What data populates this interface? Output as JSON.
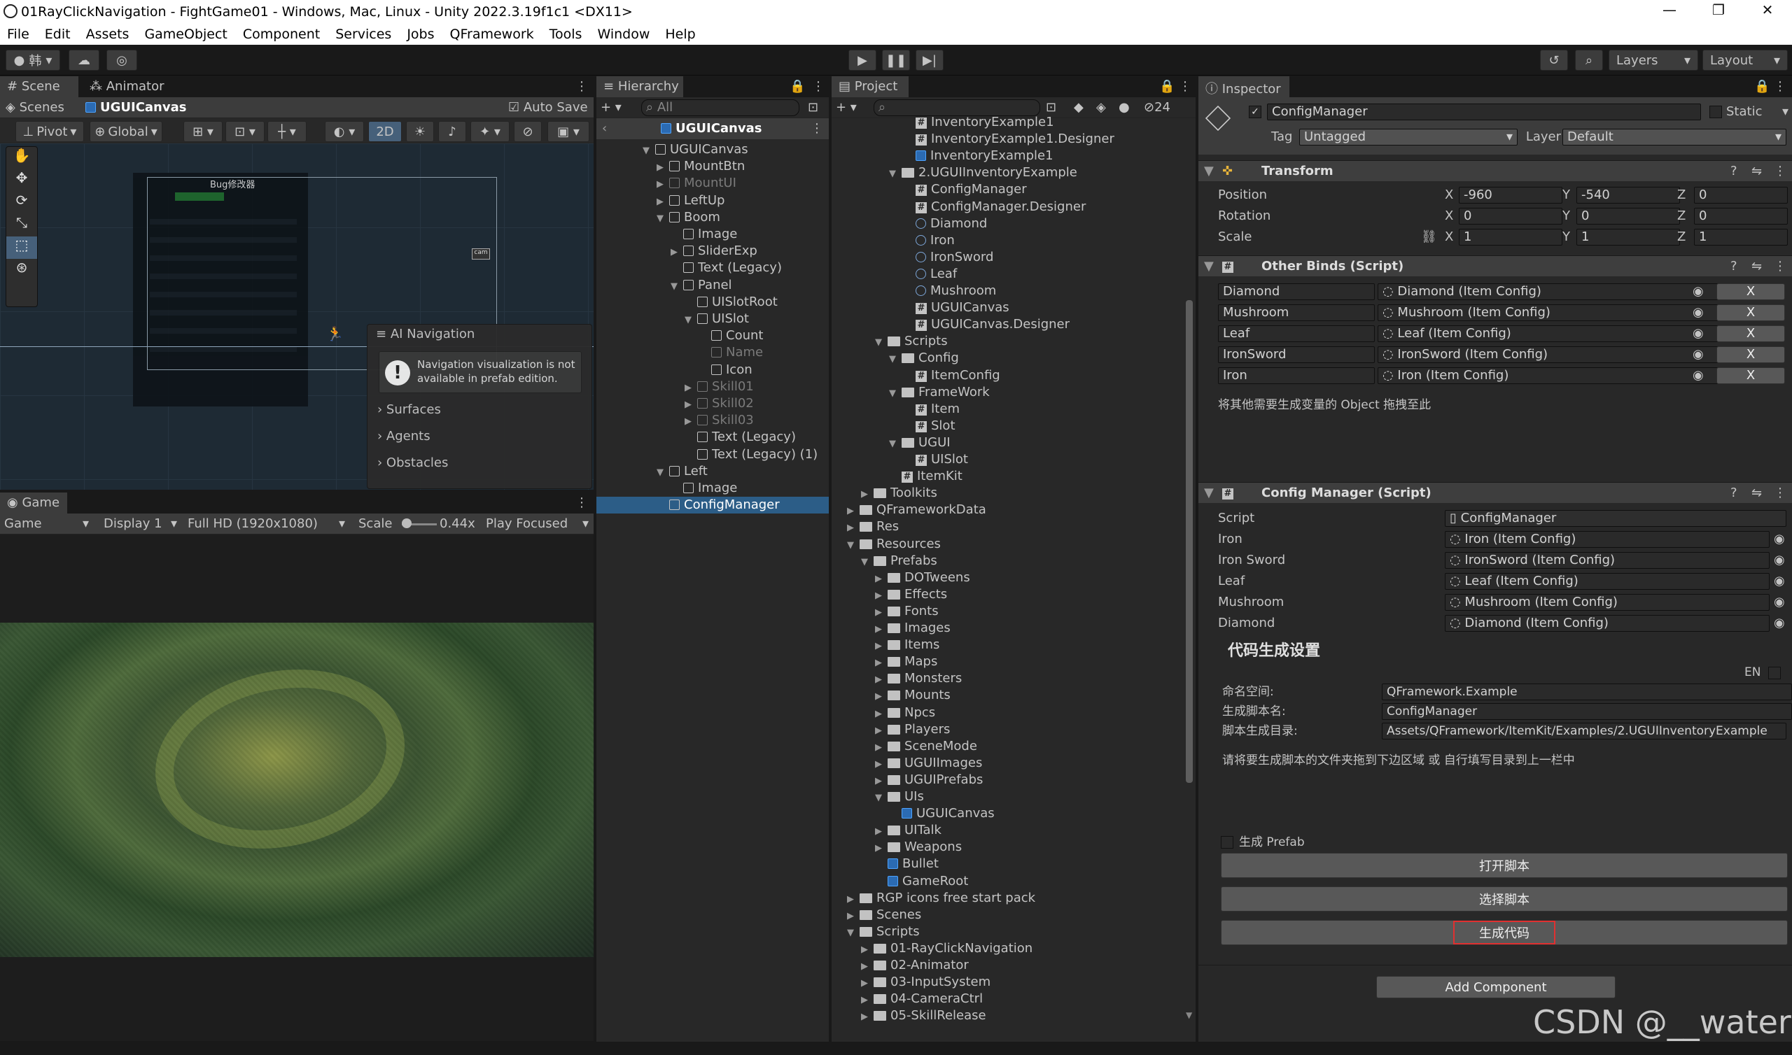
{
  "window": {
    "title": "01RayClickNavigation - FightGame01 - Windows, Mac, Linux - Unity 2022.3.19f1c1 <DX11>",
    "controls": [
      "—",
      "❐",
      "✕"
    ]
  },
  "menu": [
    "File",
    "Edit",
    "Assets",
    "GameObject",
    "Component",
    "Services",
    "Jobs",
    "QFramework",
    "Tools",
    "Window",
    "Help"
  ],
  "toolbar": {
    "account": "韩",
    "layers_label": "Layers",
    "layout_label": "Layout"
  },
  "scene": {
    "tabs": [
      "Scene",
      "Animator"
    ],
    "breadcrumb_root": "Scenes",
    "breadcrumb_object": "UGUICanvas",
    "auto_save": "Auto Save",
    "pivot": "Pivot",
    "global": "Global",
    "mode_2d": "2D",
    "ai_nav_title": "AI Navigation",
    "ai_nav_message": "Navigation visualization is not available in prefab edition.",
    "ai_nav_items": [
      "Surfaces",
      "Agents",
      "Obstacles"
    ],
    "bug_panel_title": "Bug修改器"
  },
  "game": {
    "tab": "Game",
    "mode": "Game",
    "display": "Display 1",
    "resolution": "Full HD (1920x1080)",
    "scale_label": "Scale",
    "scale_value": "0.44x",
    "play_focused": "Play Focused"
  },
  "hierarchy": {
    "tab": "Hierarchy",
    "search_placeholder": "All",
    "root": "UGUICanvas",
    "items": [
      {
        "label": "UGUICanvas",
        "depth": 0,
        "expanded": true,
        "dim": false
      },
      {
        "label": "MountBtn",
        "depth": 1,
        "expanded": false,
        "dim": false
      },
      {
        "label": "MountUI",
        "depth": 1,
        "expanded": false,
        "dim": true
      },
      {
        "label": "LeftUp",
        "depth": 1,
        "expanded": false,
        "dim": false
      },
      {
        "label": "Boom",
        "depth": 1,
        "expanded": true,
        "dim": false
      },
      {
        "label": "Image",
        "depth": 2,
        "expanded": null,
        "dim": false
      },
      {
        "label": "SliderExp",
        "depth": 2,
        "expanded": false,
        "dim": false
      },
      {
        "label": "Text (Legacy)",
        "depth": 2,
        "expanded": null,
        "dim": false
      },
      {
        "label": "Panel",
        "depth": 2,
        "expanded": true,
        "dim": false
      },
      {
        "label": "UISlotRoot",
        "depth": 3,
        "expanded": null,
        "dim": false
      },
      {
        "label": "UISlot",
        "depth": 3,
        "expanded": true,
        "dim": false
      },
      {
        "label": "Count",
        "depth": 4,
        "expanded": null,
        "dim": false
      },
      {
        "label": "Name",
        "depth": 4,
        "expanded": null,
        "dim": true
      },
      {
        "label": "Icon",
        "depth": 4,
        "expanded": null,
        "dim": false
      },
      {
        "label": "Skill01",
        "depth": 3,
        "expanded": false,
        "dim": true
      },
      {
        "label": "Skill02",
        "depth": 3,
        "expanded": false,
        "dim": true
      },
      {
        "label": "Skill03",
        "depth": 3,
        "expanded": false,
        "dim": true
      },
      {
        "label": "Text (Legacy)",
        "depth": 3,
        "expanded": null,
        "dim": false
      },
      {
        "label": "Text (Legacy) (1)",
        "depth": 3,
        "expanded": null,
        "dim": false
      },
      {
        "label": "Left",
        "depth": 1,
        "expanded": true,
        "dim": false
      },
      {
        "label": "Image",
        "depth": 2,
        "expanded": null,
        "dim": false
      },
      {
        "label": "ConfigManager",
        "depth": 1,
        "expanded": null,
        "dim": false,
        "selected": true
      }
    ]
  },
  "project": {
    "tab": "Project",
    "badge": "24",
    "items": [
      {
        "label": "InventoryExample1",
        "depth": 4,
        "icon": "hash",
        "arrow": ""
      },
      {
        "label": "InventoryExample1.Designer",
        "depth": 4,
        "icon": "hash",
        "arrow": ""
      },
      {
        "label": "InventoryExample1",
        "depth": 4,
        "icon": "cube",
        "arrow": ""
      },
      {
        "label": "2.UGUIInventoryExample",
        "depth": 3,
        "icon": "folder",
        "arrow": "▼"
      },
      {
        "label": "ConfigManager",
        "depth": 4,
        "icon": "hash",
        "arrow": ""
      },
      {
        "label": "ConfigManager.Designer",
        "depth": 4,
        "icon": "hash",
        "arrow": ""
      },
      {
        "label": "Diamond",
        "depth": 4,
        "icon": "cfg",
        "arrow": ""
      },
      {
        "label": "Iron",
        "depth": 4,
        "icon": "cfg",
        "arrow": ""
      },
      {
        "label": "IronSword",
        "depth": 4,
        "icon": "cfg",
        "arrow": ""
      },
      {
        "label": "Leaf",
        "depth": 4,
        "icon": "cfg",
        "arrow": ""
      },
      {
        "label": "Mushroom",
        "depth": 4,
        "icon": "cfg",
        "arrow": ""
      },
      {
        "label": "UGUICanvas",
        "depth": 4,
        "icon": "hash",
        "arrow": ""
      },
      {
        "label": "UGUICanvas.Designer",
        "depth": 4,
        "icon": "hash",
        "arrow": ""
      },
      {
        "label": "Scripts",
        "depth": 2,
        "icon": "folder",
        "arrow": "▼"
      },
      {
        "label": "Config",
        "depth": 3,
        "icon": "folder",
        "arrow": "▼"
      },
      {
        "label": "ItemConfig",
        "depth": 4,
        "icon": "hash",
        "arrow": ""
      },
      {
        "label": "FrameWork",
        "depth": 3,
        "icon": "folder",
        "arrow": "▼"
      },
      {
        "label": "Item",
        "depth": 4,
        "icon": "hash",
        "arrow": ""
      },
      {
        "label": "Slot",
        "depth": 4,
        "icon": "hash",
        "arrow": ""
      },
      {
        "label": "UGUI",
        "depth": 3,
        "icon": "folder",
        "arrow": "▼"
      },
      {
        "label": "UISlot",
        "depth": 4,
        "icon": "hash",
        "arrow": ""
      },
      {
        "label": "ItemKit",
        "depth": 3,
        "icon": "hash",
        "arrow": ""
      },
      {
        "label": "Toolkits",
        "depth": 1,
        "icon": "folder",
        "arrow": "▶"
      },
      {
        "label": "QFrameworkData",
        "depth": 0,
        "icon": "folder",
        "arrow": "▶"
      },
      {
        "label": "Res",
        "depth": 0,
        "icon": "folder",
        "arrow": "▶"
      },
      {
        "label": "Resources",
        "depth": 0,
        "icon": "folder",
        "arrow": "▼"
      },
      {
        "label": "Prefabs",
        "depth": 1,
        "icon": "folder",
        "arrow": "▼"
      },
      {
        "label": "DOTweens",
        "depth": 2,
        "icon": "folder",
        "arrow": "▶"
      },
      {
        "label": "Effects",
        "depth": 2,
        "icon": "folder",
        "arrow": "▶"
      },
      {
        "label": "Fonts",
        "depth": 2,
        "icon": "folder",
        "arrow": "▶"
      },
      {
        "label": "Images",
        "depth": 2,
        "icon": "folder",
        "arrow": "▶"
      },
      {
        "label": "Items",
        "depth": 2,
        "icon": "folder",
        "arrow": "▶"
      },
      {
        "label": "Maps",
        "depth": 2,
        "icon": "folder",
        "arrow": "▶"
      },
      {
        "label": "Monsters",
        "depth": 2,
        "icon": "folder",
        "arrow": "▶"
      },
      {
        "label": "Mounts",
        "depth": 2,
        "icon": "folder",
        "arrow": "▶"
      },
      {
        "label": "Npcs",
        "depth": 2,
        "icon": "folder",
        "arrow": "▶"
      },
      {
        "label": "Players",
        "depth": 2,
        "icon": "folder",
        "arrow": "▶"
      },
      {
        "label": "SceneMode",
        "depth": 2,
        "icon": "folder",
        "arrow": "▶"
      },
      {
        "label": "UGUIImages",
        "depth": 2,
        "icon": "folder",
        "arrow": "▶"
      },
      {
        "label": "UGUIPrefabs",
        "depth": 2,
        "icon": "folder",
        "arrow": "▶"
      },
      {
        "label": "UIs",
        "depth": 2,
        "icon": "folder",
        "arrow": "▼"
      },
      {
        "label": "UGUICanvas",
        "depth": 3,
        "icon": "cube",
        "arrow": ""
      },
      {
        "label": "UITalk",
        "depth": 2,
        "icon": "folder",
        "arrow": "▶"
      },
      {
        "label": "Weapons",
        "depth": 2,
        "icon": "folder",
        "arrow": "▶"
      },
      {
        "label": "Bullet",
        "depth": 2,
        "icon": "cube",
        "arrow": ""
      },
      {
        "label": "GameRoot",
        "depth": 2,
        "icon": "cube",
        "arrow": ""
      },
      {
        "label": "RGP icons free start pack",
        "depth": 0,
        "icon": "folder",
        "arrow": "▶"
      },
      {
        "label": "Scenes",
        "depth": 0,
        "icon": "folder",
        "arrow": "▶"
      },
      {
        "label": "Scripts",
        "depth": 0,
        "icon": "folder",
        "arrow": "▼"
      },
      {
        "label": "01-RayClickNavigation",
        "depth": 1,
        "icon": "folder",
        "arrow": "▶"
      },
      {
        "label": "02-Animator",
        "depth": 1,
        "icon": "folder",
        "arrow": "▶"
      },
      {
        "label": "03-InputSystem",
        "depth": 1,
        "icon": "folder",
        "arrow": "▶"
      },
      {
        "label": "04-CameraCtrl",
        "depth": 1,
        "icon": "folder",
        "arrow": "▶"
      },
      {
        "label": "05-SkillRelease",
        "depth": 1,
        "icon": "folder",
        "arrow": "▶"
      }
    ]
  },
  "inspector": {
    "tab": "Inspector",
    "object_name": "ConfigManager",
    "static_label": "Static",
    "tag_label": "Tag",
    "tag_value": "Untagged",
    "layer_label": "Layer",
    "layer_value": "Default",
    "transform": {
      "title": "Transform",
      "position_label": "Position",
      "position": [
        "-960",
        "-540",
        "0"
      ],
      "rotation_label": "Rotation",
      "rotation": [
        "0",
        "0",
        "0"
      ],
      "scale_label": "Scale",
      "scale": [
        "1",
        "1",
        "1"
      ]
    },
    "other_binds": {
      "title": "Other Binds (Script)",
      "rows": [
        {
          "name": "Diamond",
          "value": "Diamond (Item Config)"
        },
        {
          "name": "Mushroom",
          "value": "Mushroom (Item Config)"
        },
        {
          "name": "Leaf",
          "value": "Leaf (Item Config)"
        },
        {
          "name": "IronSword",
          "value": "IronSword (Item Config)"
        },
        {
          "name": "Iron",
          "value": "Iron (Item Config)"
        }
      ],
      "remove_label": "X",
      "hint": "将其他需要生成变量的 Object 拖拽至此"
    },
    "config_manager": {
      "title": "Config Manager (Script)",
      "script_label": "Script",
      "script_value": "ConfigManager",
      "fields": [
        {
          "name": "Iron",
          "value": "Iron (Item Config)"
        },
        {
          "name": "Iron Sword",
          "value": "IronSword (Item Config)"
        },
        {
          "name": "Leaf",
          "value": "Leaf (Item Config)"
        },
        {
          "name": "Mushroom",
          "value": "Mushroom (Item Config)"
        },
        {
          "name": "Diamond",
          "value": "Diamond (Item Config)"
        }
      ]
    },
    "codegen": {
      "title": "代码生成设置",
      "en_label": "EN",
      "namespace_label": "命名空间:",
      "namespace_value": "QFramework.Example",
      "script_name_label": "生成脚本名:",
      "script_name_value": "ConfigManager",
      "dir_label": "脚本生成目录:",
      "dir_value": "Assets/QFramework/ItemKit/Examples/2.UGUIInventoryExample",
      "drop_hint": "请将要生成脚本的文件夹拖到下边区域 或 自行填写目录到上一栏中",
      "prefab_label": "生成 Prefab",
      "open_script": "打开脚本",
      "select_script": "选择脚本",
      "generate_code": "生成代码"
    },
    "add_component": "Add Component"
  },
  "watermark": "CSDN @__water",
  "colors": {
    "highlight": "#e03030",
    "selection": "#2c5d87"
  }
}
